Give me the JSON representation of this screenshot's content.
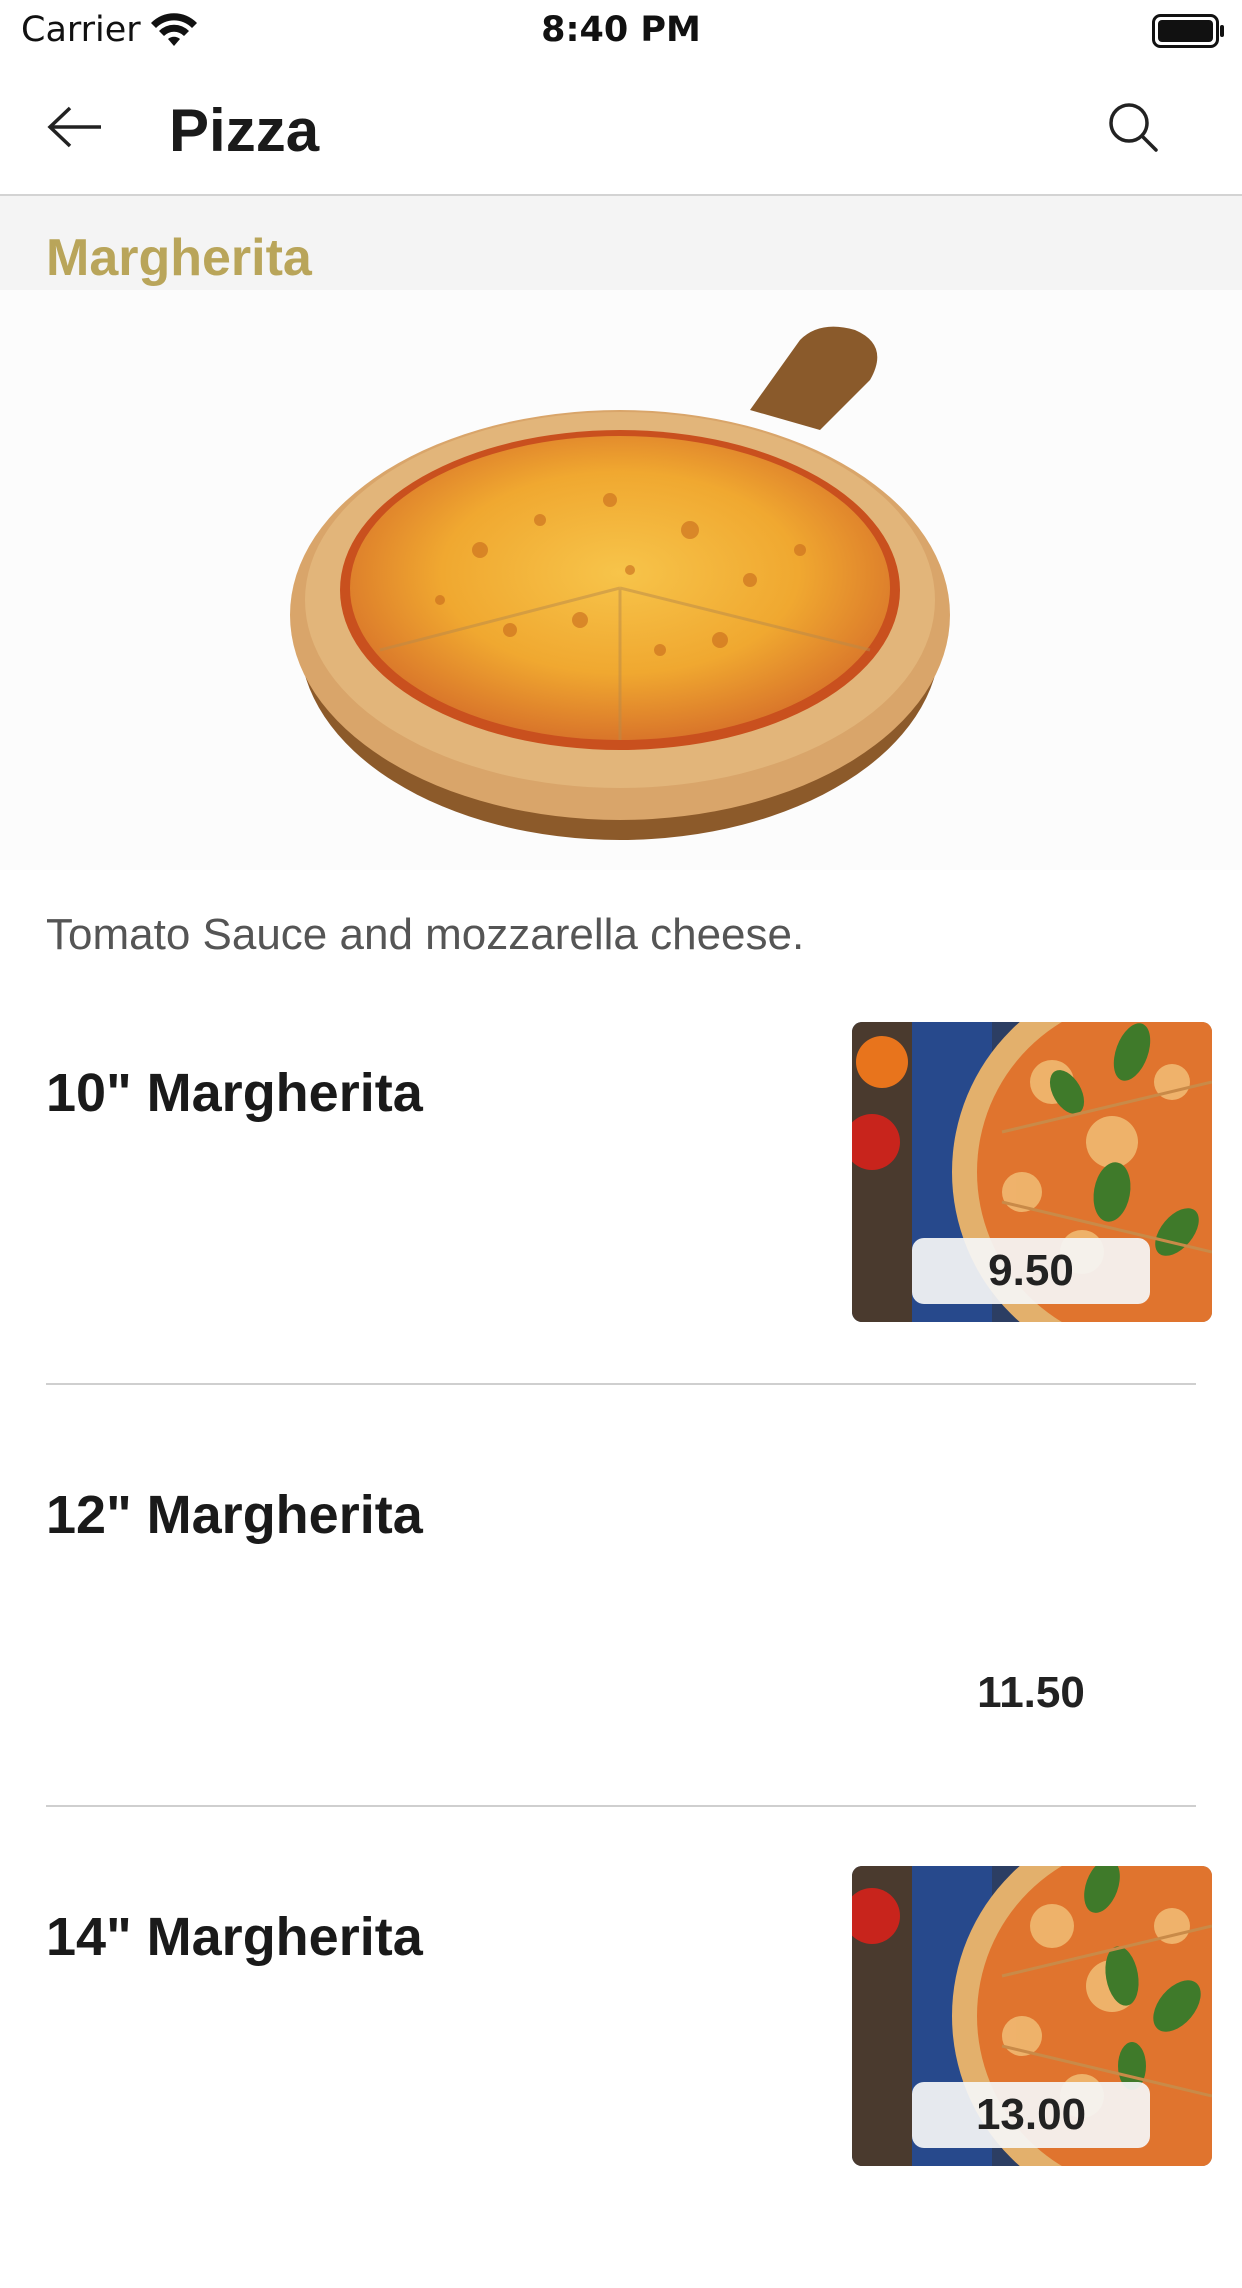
{
  "status_bar": {
    "carrier": "Carrier",
    "time": "8:40 PM",
    "icons": [
      "wifi-icon",
      "battery-icon"
    ]
  },
  "nav": {
    "title": "Pizza",
    "back_icon": "arrow-left-icon",
    "search_icon": "search-icon"
  },
  "section": {
    "title": "Margherita",
    "title_color": "#b9a55a",
    "description": "Tomato Sauce and mozzarella cheese."
  },
  "items": [
    {
      "name": "10\" Margherita",
      "price": "9.50",
      "has_image": true
    },
    {
      "name": "12\" Margherita",
      "price": "11.50",
      "has_image": false
    },
    {
      "name": "14\" Margherita",
      "price": "13.00",
      "has_image": true
    }
  ]
}
